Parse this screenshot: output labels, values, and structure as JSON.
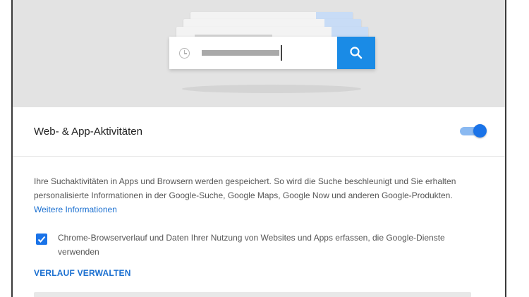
{
  "illustration": {
    "search_icon": "search-icon",
    "history_icon": "clock-icon"
  },
  "section": {
    "title": "Web- & App-Aktivitäten",
    "toggle_on": true
  },
  "description": {
    "text": "Ihre Suchaktivitäten in Apps und Browsern werden gespeichert. So wird die Suche beschleunigt und Sie erhalten personalisierte Informationen in der Google-Suche, Google Maps, Google Now und anderen Google-Produkten.",
    "link": "Weitere Informationen"
  },
  "checkbox": {
    "checked": true,
    "label": "Chrome-Browserverlauf und Daten Ihrer Nutzung von Websites und Apps erfassen, die Google-Dienste verwenden"
  },
  "manage_link": "VERLAUF VERWALTEN",
  "colors": {
    "accent": "#1a73e8",
    "link": "#1a6fd0",
    "hero_bg": "#e3e3e3"
  }
}
